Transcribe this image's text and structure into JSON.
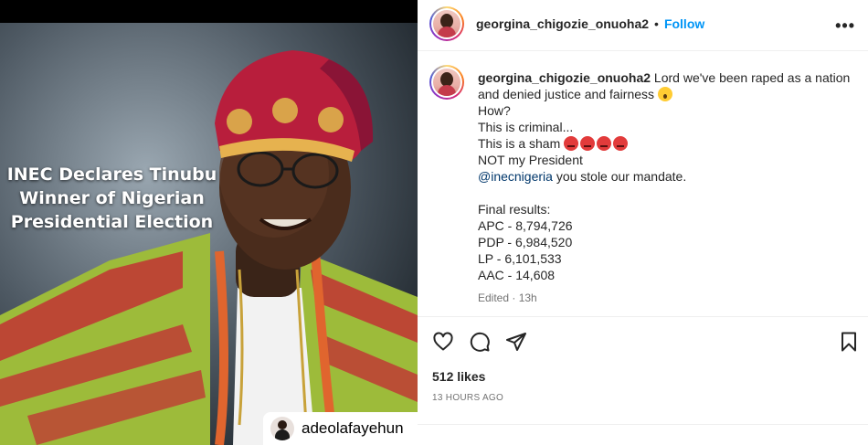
{
  "post": {
    "overlay_lines": [
      "INEC Declares Tinubu",
      "Winner of Nigerian",
      "Presidential Election"
    ],
    "photo_credit": "adeolafayehun"
  },
  "header": {
    "username": "georgina_chigozie_onuoha2",
    "separator": "•",
    "follow_label": "Follow",
    "more_label": "•••"
  },
  "caption": {
    "username": "georgina_chigozie_onuoha2",
    "first_line": "Lord we've been raped as a nation",
    "second_line": "and denied justice and fairness",
    "lines_a": [
      "How?",
      "This is criminal..."
    ],
    "sham_text": "This is a sham",
    "not_president": "NOT my President",
    "mention": "@inecnigeria",
    "mention_rest": "you stole our mandate.",
    "results_title": "Final results:",
    "results": [
      "APC - 8,794,726",
      "PDP - 6,984,520",
      "LP - 6,101,533",
      "AAC - 14,608"
    ],
    "edited": "Edited · 13h"
  },
  "actions": {
    "icons": [
      "heart-icon",
      "comment-icon",
      "share-icon",
      "bookmark-icon"
    ],
    "likes": "512 likes",
    "time_ago": "13 HOURS AGO"
  },
  "colors": {
    "accent": "#0095f6",
    "text": "#262626",
    "muted": "#737373",
    "mention": "#00376b"
  }
}
